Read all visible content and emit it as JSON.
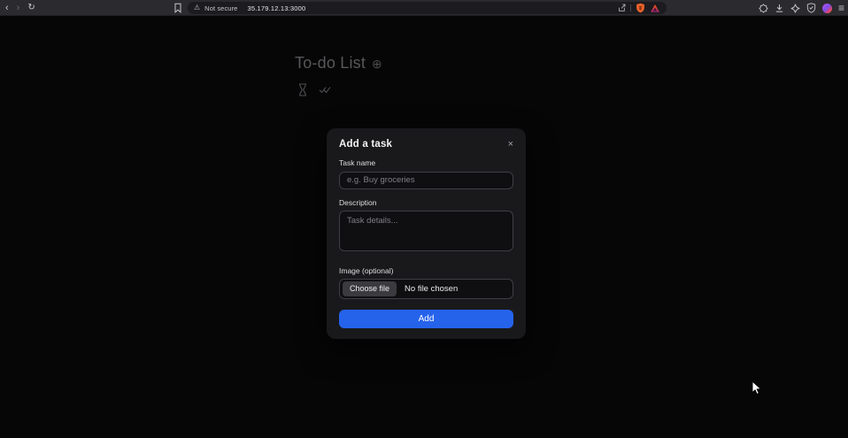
{
  "browser": {
    "security_label": "Not secure",
    "url": "35.179.12.13:3000"
  },
  "page": {
    "title": "To-do List"
  },
  "modal": {
    "title": "Add a task",
    "task_name": {
      "label": "Task name",
      "placeholder": "e.g. Buy groceries",
      "value": ""
    },
    "description": {
      "label": "Description",
      "placeholder": "Task details...",
      "value": ""
    },
    "image": {
      "label": "Image (optional)",
      "choose_button": "Choose file",
      "status": "No file chosen"
    },
    "submit": "Add"
  },
  "icons": {
    "back": "‹",
    "forward": "›",
    "reload": "↻",
    "warning": "⚠",
    "plus_circle": "⊕",
    "close": "×",
    "menu": "≡"
  },
  "colors": {
    "accent_blue": "#2563eb",
    "toolbar_bg": "#2b2a2e",
    "addressbar_bg": "#1c1b1f",
    "modal_bg": "#19191c",
    "shields_orange": "#e8632c",
    "page_bg": "#060607"
  }
}
